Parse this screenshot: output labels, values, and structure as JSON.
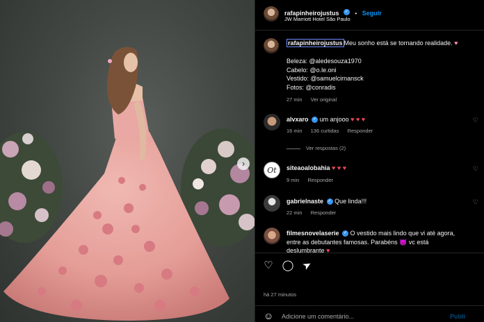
{
  "post": {
    "account": "rafapinheirojustus",
    "follow_label": "Seguir",
    "location": "JW Marriott Hotel São Paulo",
    "caption": {
      "username": "rafapinheirojustus",
      "text": "Meu sonho está se tornando realidade.",
      "heart": "♥",
      "credits": [
        "Beleza: @aledesouza1970",
        "Cabelo: @o.le.oni",
        "Vestido: @samuelcirnansck",
        "Fotos: @conradis"
      ],
      "time": "27 min",
      "see_original": "Ver original"
    },
    "comments": [
      {
        "username": "alvxaro",
        "verified": true,
        "text": "um anjooo",
        "emoji": "♥ ♥ ♥",
        "time": "16 min",
        "likes": "136 curtidas",
        "reply": "Responder",
        "view_replies": "Ver respostas (2)"
      },
      {
        "username": "siteaoalobahia",
        "verified": false,
        "avatar_text": "Ot",
        "text": "",
        "emoji": "♥ ♥ ♥",
        "time": "9 min",
        "reply": "Responder"
      },
      {
        "username": "gabrielnaste",
        "verified": true,
        "text": "Que linda!!!",
        "time": "22 min",
        "reply": "Responder"
      },
      {
        "username": "filmesnovelaserie",
        "verified": true,
        "text_line1": "O vestido mais lindo que vi até agora,",
        "text_line2": "entre as debutantes famosas. Parabéns",
        "emoji_inline": "😈",
        "text_after_emoji": "vc está",
        "text_line3": "deslumbrante",
        "heart": "♥"
      }
    ],
    "timestamp": "há 27 minutos",
    "comment_placeholder": "Adicione um comentário...",
    "publish_label": "Publi"
  },
  "icons": {
    "verified": "✓",
    "like": "♡",
    "comment": "◯",
    "share": "➤",
    "next": "›",
    "emoji": "☺",
    "small_like": "♡"
  },
  "colors": {
    "accent": "#0095f6",
    "heart": "#ed4956",
    "dress": "#e8a3a0",
    "background": "#000000"
  }
}
